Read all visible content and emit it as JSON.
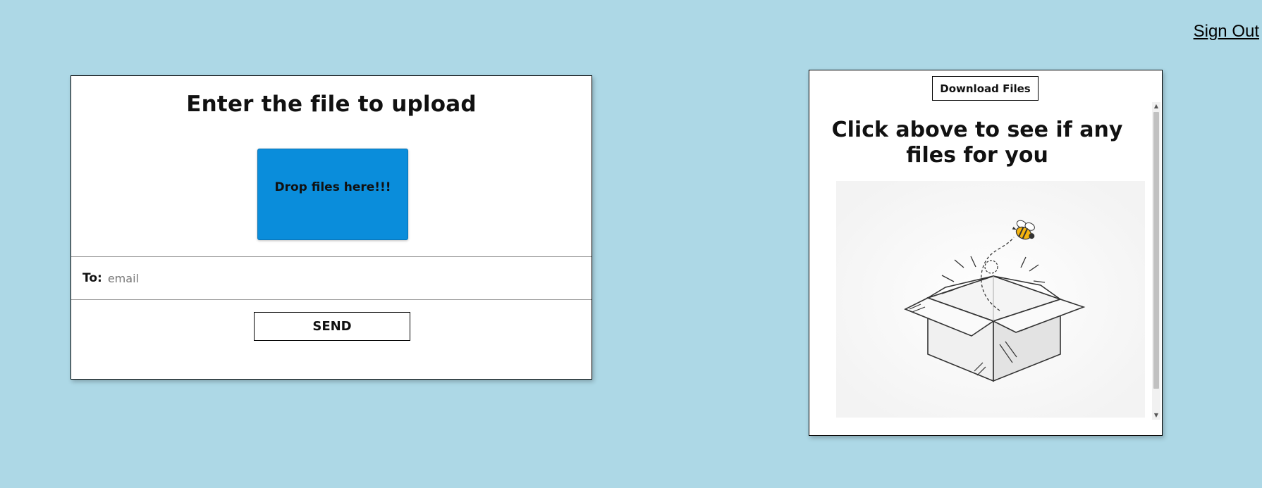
{
  "header": {
    "signout_label": "Sign Out"
  },
  "upload": {
    "title": "Enter the file to upload",
    "dropzone_label": "Drop files here!!!",
    "to_label": "To:",
    "email_placeholder": "email",
    "send_label": "SEND"
  },
  "download": {
    "button_label": "Download Files",
    "message": "Click above to see if any files for you",
    "illustration": "empty-box-with-bee-icon"
  },
  "colors": {
    "background": "#add8e6",
    "dropzone": "#0a8ddb",
    "bee_yellow": "#f5b40f"
  }
}
